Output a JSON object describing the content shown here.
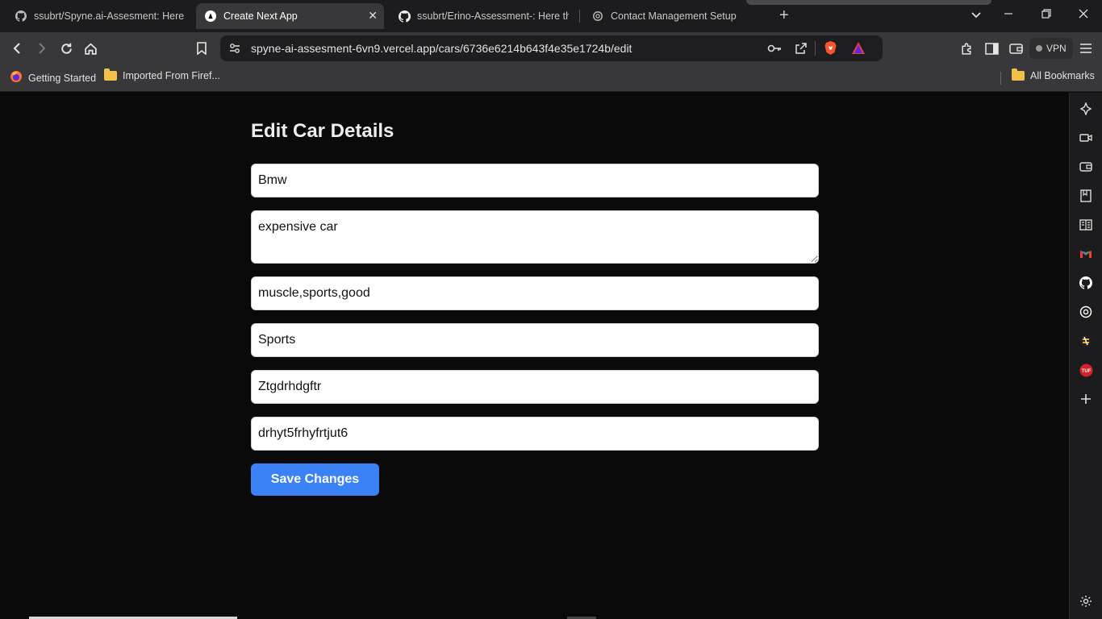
{
  "browser": {
    "tabs": [
      {
        "label": "ssubrt/Spyne.ai-Assesment: Here th",
        "icon": "github-icon",
        "active": false
      },
      {
        "label": "Create Next App",
        "icon": "nextjs-icon",
        "active": true
      },
      {
        "label": "ssubrt/Erino-Assessment-: Here the",
        "icon": "github-icon",
        "active": false
      },
      {
        "label": "Contact Management Setup",
        "icon": "openai-icon",
        "active": false
      }
    ],
    "url": "spyne-ai-assesment-6vn9.vercel.app/cars/6736e6214b643f4e35e1724b/edit",
    "vpn_label": "VPN",
    "bookmarks": [
      {
        "label": "Getting Started",
        "icon": "firefox-icon"
      },
      {
        "label": "Imported From Firef...",
        "icon": "folder-icon"
      }
    ],
    "all_bookmarks_label": "All Bookmarks"
  },
  "page": {
    "title": "Edit Car Details",
    "fields": {
      "title_value": "Bmw",
      "description_value": "expensive car",
      "tags_value": "muscle,sports,good",
      "car_type_value": "Sports",
      "company_value": "Ztgdrhdgftr",
      "dealer_value": "drhyt5frhyfrtjut6"
    },
    "save_label": "Save Changes"
  },
  "colors": {
    "page_background": "#0a0a0a",
    "button_accent": "#3b82f6",
    "browser_chrome": "#38383a"
  }
}
